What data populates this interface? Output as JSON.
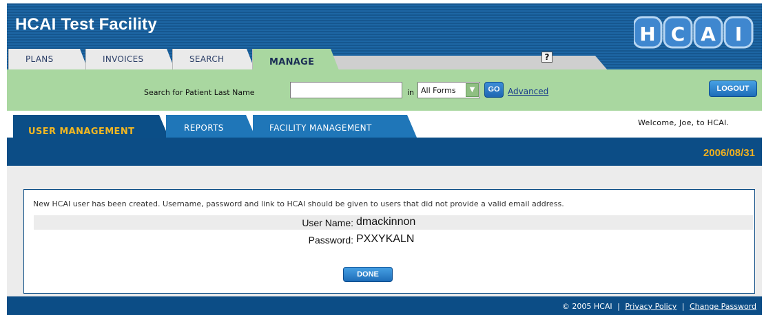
{
  "header": {
    "facility_name": "HCAI Test Facility",
    "logo_letters": [
      "H",
      "C",
      "A",
      "I"
    ],
    "help_label": "?"
  },
  "main_tabs": [
    {
      "label": "PLANS",
      "active": false
    },
    {
      "label": "INVOICES",
      "active": false
    },
    {
      "label": "SEARCH",
      "active": false
    },
    {
      "label": "MANAGE",
      "active": true
    }
  ],
  "search": {
    "label": "Search for Patient Last Name",
    "value": "",
    "in_label": "in",
    "forms_selected": "All Forms",
    "go_label": "GO",
    "advanced_label": "Advanced"
  },
  "logout_label": "LOGOUT",
  "sub_tabs": [
    {
      "label": "USER MANAGEMENT",
      "active": true
    },
    {
      "label": "REPORTS",
      "active": false
    },
    {
      "label": "FACILITY MANAGEMENT",
      "active": false
    }
  ],
  "welcome": "Welcome, Joe, to HCAI.",
  "date": "2006/08/31",
  "result": {
    "message": "New HCAI user has been created. Username, password and link to HCAI should be given to users that did not provide a valid email address.",
    "username_label": "User Name:",
    "username_value": "dmackinnon",
    "password_label": "Password:",
    "password_value": "PXXYKALN",
    "done_label": "DONE"
  },
  "footer": {
    "copyright": "© 2005 HCAI",
    "privacy_label": "Privacy Policy",
    "separator": "|",
    "change_password_label": "Change Password"
  },
  "colors": {
    "header_blue": "#1d66a4",
    "dark_blue": "#0c4d86",
    "green_bar": "#a9d7a0",
    "date_gold": "#f1b11f",
    "active_subtab_text": "#f2b722"
  }
}
